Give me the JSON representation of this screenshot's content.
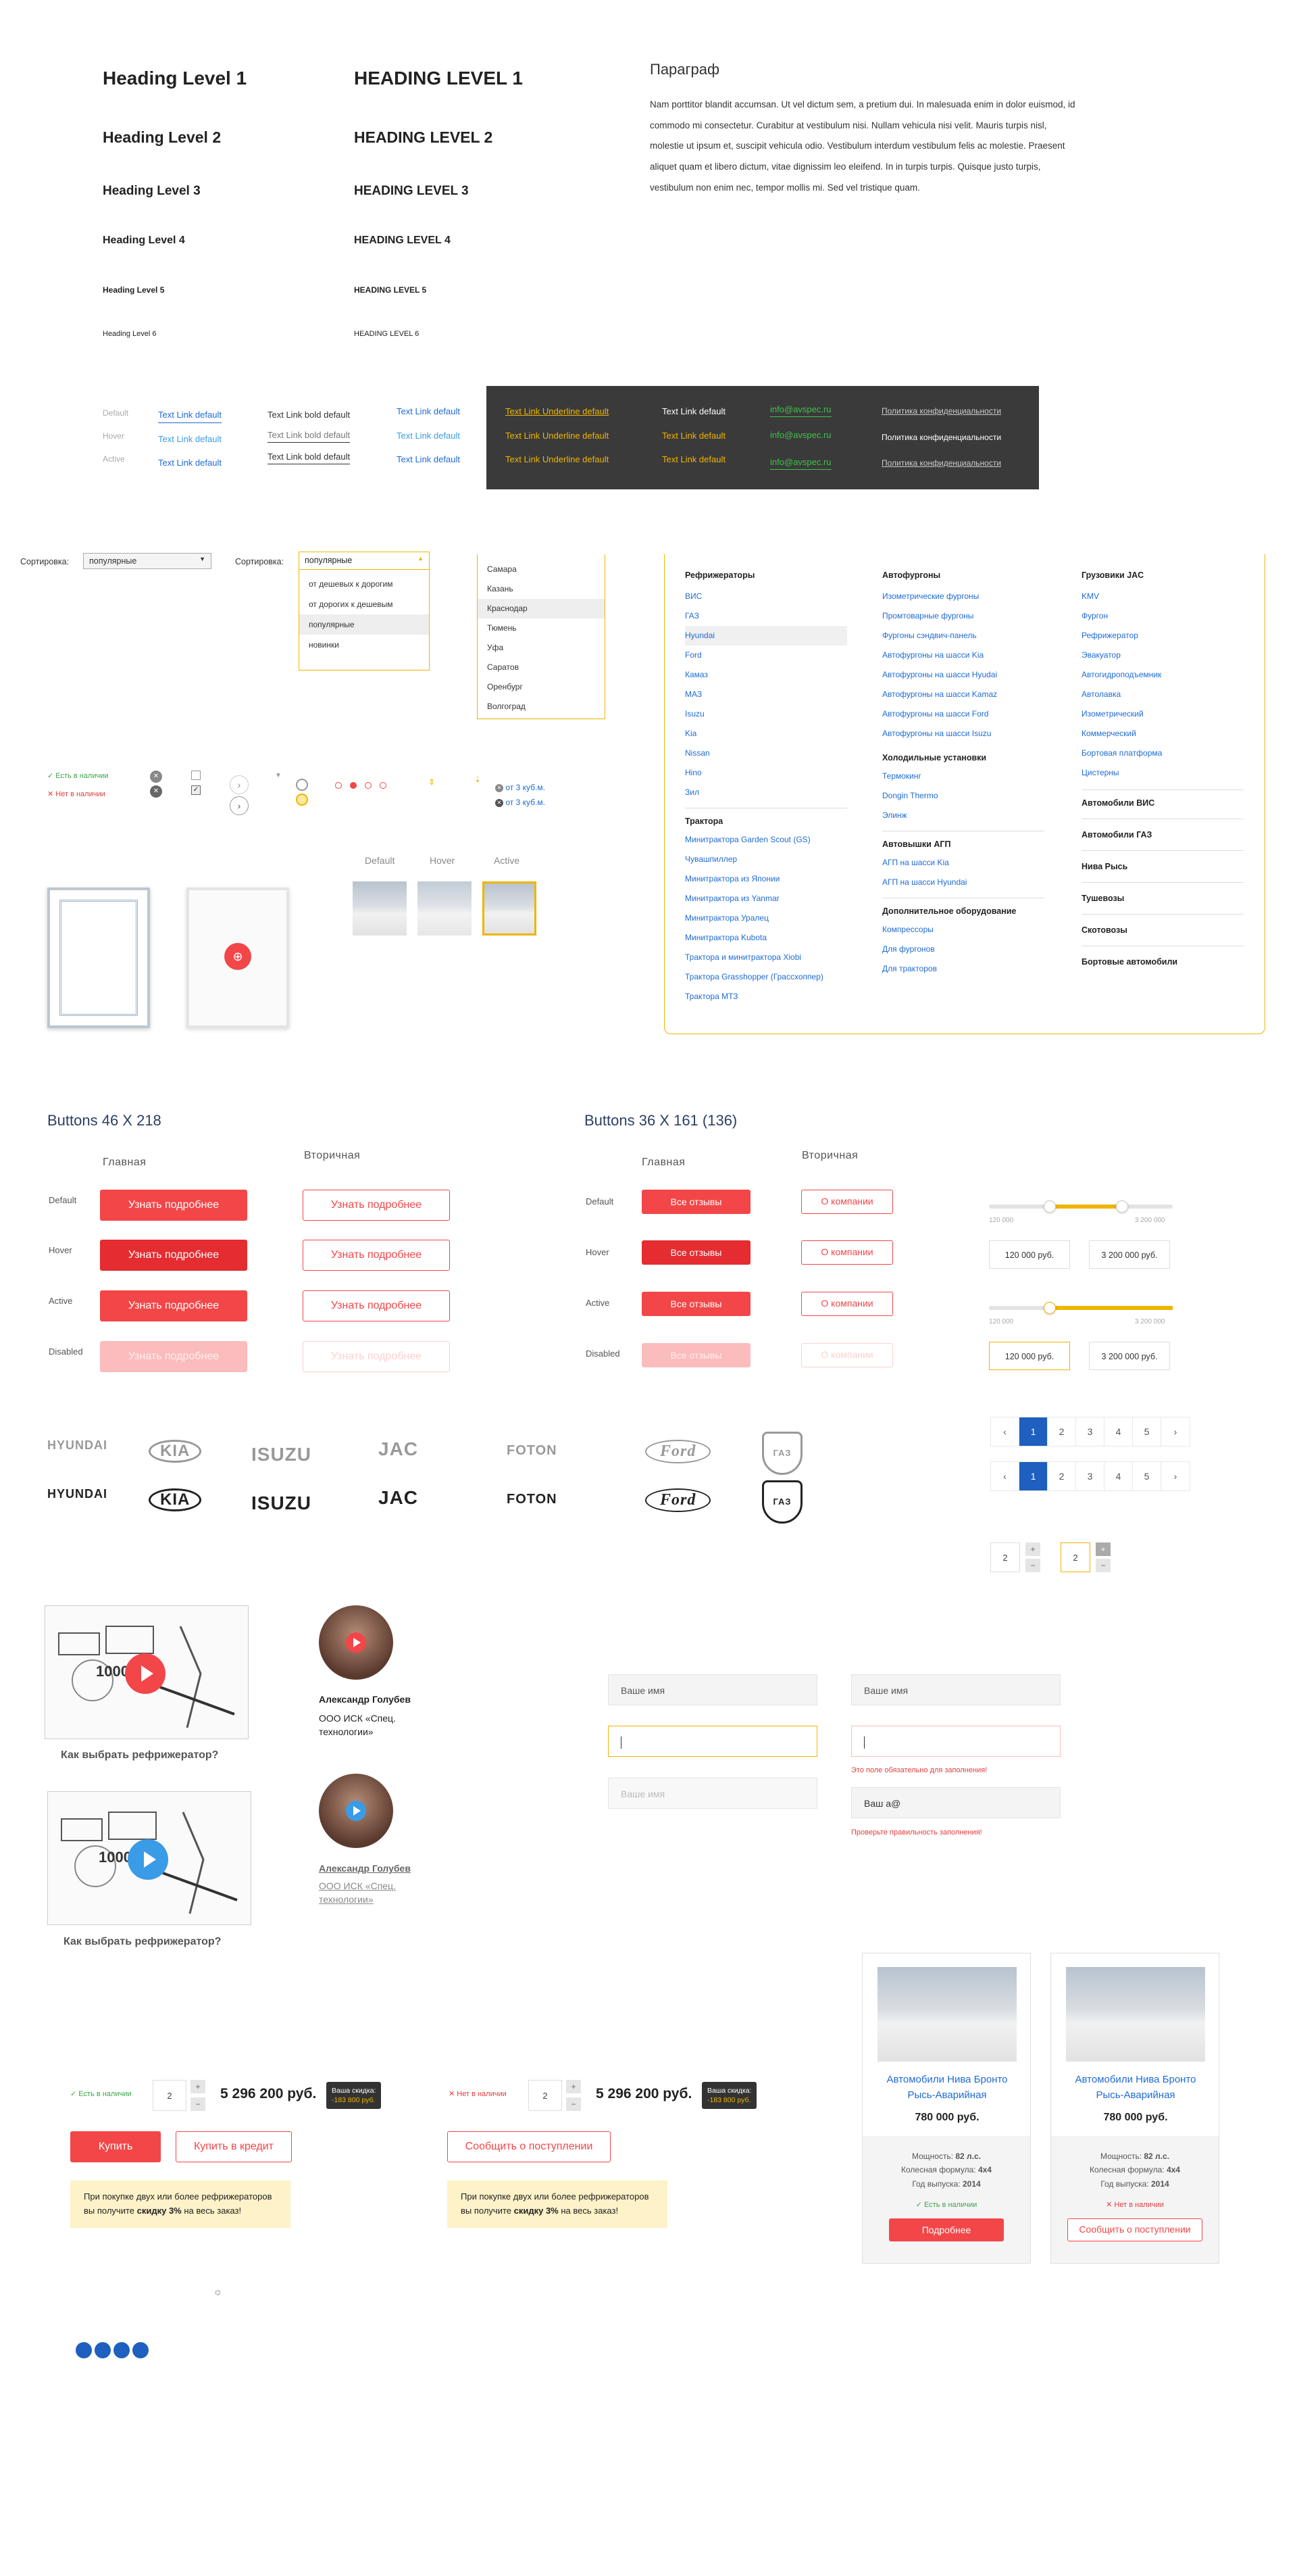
{
  "headings": {
    "h1": "Heading Level 1",
    "h2": "Heading Level 2",
    "h3": "Heading Level 3",
    "h4": "Heading Level 4",
    "h5": "Heading Level 5",
    "h6": "Heading Level 6",
    "h1u": "HEADING LEVEL 1",
    "h2u": "HEADING LEVEL 2",
    "h3u": "HEADING LEVEL 3",
    "h4u": "HEADING LEVEL 4",
    "h5u": "HEADING LEVEL 5",
    "h6u": "HEADING LEVEL 6"
  },
  "paragraph": {
    "title": "Параграф",
    "text": "Nam porttitor blandit accumsan. Ut vel dictum sem, a pretium dui. In malesuada enim in dolor euismod, id commodo mi consectetur. Curabitur at vestibulum nisi. Nullam vehicula nisi velit. Mauris turpis nisl, molestie ut ipsum et, suscipit vehicula odio. Vestibulum interdum vestibulum felis ac molestie. Praesent aliquet quam et libero dictum, vitae dignissim leo eleifend. In in turpis turpis. Quisque justo turpis, vestibulum non enim nec, tempor mollis mi. Sed vel tristique quam."
  },
  "links": {
    "states": [
      "Default",
      "Hover",
      "Active"
    ],
    "text_link_default": "Text Link default",
    "text_link_bold_default": "Text Link bold default",
    "underline_default": "Text Link Underline default",
    "email": "info@avspec.ru",
    "privacy": "Политика конфиденциальности"
  },
  "sort": {
    "label": "Сортировка:",
    "value": "популярные",
    "options": [
      "от дешевых к дорогим",
      "от дорогих к дешевым",
      "популярные",
      "новинки"
    ]
  },
  "cities": [
    "Самара",
    "Казань",
    "Краснодар",
    "Тюмень",
    "Уфа",
    "Саратов",
    "Оренбург",
    "Волгоград"
  ],
  "mega": {
    "col1": {
      "title": "Рефрижераторы",
      "items": [
        "ВИС",
        "ГАЗ",
        "Hyundai",
        "Ford",
        "Камаз",
        "МАЗ",
        "Isuzu",
        "Kia",
        "Nissan",
        "Hino",
        "Зил"
      ],
      "title2": "Трактора",
      "items2": [
        "Минитрактора Garden Scout (GS)",
        "Чувашпиллер",
        "Минитрактора из Японии",
        "Минитрактора из Yanmar",
        "Минитрактора Уралец",
        "Минитрактора Kubota",
        "Трактора и минитрактора Xiobi",
        "Трактора Grasshopper (Грассхоппер)",
        "Трактора МТЗ"
      ]
    },
    "col2": {
      "title": "Автофургоны",
      "items": [
        "Изометрические фургоны",
        "Промтоварные фургоны",
        "Фургоны сэндвич-панель",
        "Автофургоны на шасси Kia",
        "Автофургоны на шасси Hyudai",
        "Автофургоны на шасси Kamaz",
        "Автофургоны на шасси Ford",
        "Автофургоны на шасси Isuzu"
      ],
      "title2": "Холодильные установки",
      "items2": [
        "Термокинг",
        "Dongin Thermo",
        "Элинж"
      ],
      "title3": "Автовышки АГП",
      "items3": [
        "АГП на шасси Kia",
        "АГП на шасси Hyundai"
      ],
      "title4": "Дополнительное оборудование",
      "items4": [
        "Компрессоры",
        "Для фургонов",
        "Для тракторов"
      ]
    },
    "col3": {
      "title": "Грузовики JAC",
      "items": [
        "KMV",
        "Фургон",
        "Рефрижератор",
        "Эвакуатор",
        "Автогидроподъемник",
        "Автолавка",
        "Изометрический",
        "Коммерческий",
        "Бортовая платформа",
        "Цистерны"
      ],
      "extra": [
        "Автомобили ВИС",
        "Автомобили ГАЗ",
        "Нива Рысь",
        "Тушевозы",
        "Скотовозы",
        "Бортовые автомобили"
      ]
    }
  },
  "status": {
    "in_stock": "Есть в наличии",
    "out_of_stock": "Нет в наличии",
    "volume": "от 3 куб.м."
  },
  "thumb_states": [
    "Default",
    "Hover",
    "Active"
  ],
  "buttons": {
    "title_large": "Buttons 46 X 218",
    "title_small": "Buttons 36 X 161 (136)",
    "primary": "Главная",
    "secondary": "Вторичная",
    "rows": [
      "Default",
      "Hover",
      "Active",
      "Disabled"
    ],
    "learn_more": "Узнать подробнее",
    "reviews": "Все отзывы",
    "about": "О компании"
  },
  "slider": {
    "min": "120 000",
    "max": "3 200 000",
    "from": "120 000 руб.",
    "to": "3 200 000 руб.",
    "from_value": 120000,
    "to_value": 3200000,
    "handle_value_1": 2400000,
    "handle_value_2": 1100000
  },
  "brands": [
    "HYUNDAI",
    "KIA",
    "ISUZU",
    "JAC",
    "FOTON",
    "Ford",
    "ГАЗ"
  ],
  "pagination": {
    "prev": "‹",
    "next": "›",
    "pages": [
      "1",
      "2",
      "3",
      "4",
      "5"
    ],
    "current": "1"
  },
  "qty_examples": [
    "2",
    "2"
  ],
  "video": {
    "caption": "Как выбрать рефрижератор?",
    "counter": "1000"
  },
  "person": {
    "name": "Александр Голубев",
    "org": "ООО ИСК «Спец. технологии»"
  },
  "form": {
    "placeholder": "Ваше имя",
    "filled": "Ваш а@",
    "err_required": "Это поле обязательно для заполнения!",
    "err_check": "Проверьте правильность заполнения!"
  },
  "product": {
    "qty": "2",
    "price": "5 296 200 руб.",
    "discount_label": "Ваша скидка:",
    "discount_value": "-183 800 руб.",
    "buy": "Купить",
    "credit": "Купить в кредит",
    "notify": "Сообщить о поступлении",
    "promo_1": "При покупке двух или более рефрижераторов",
    "promo_2a": "вы получите ",
    "promo_2b": "скидку 3%",
    "promo_2c": " на весь заказ!"
  },
  "card": {
    "title": "Автомобили Нива Бронто Рысь-Аварийная",
    "price": "780 000 руб.",
    "power_lbl": "Мощность:",
    "power": "82 л.с.",
    "wheel_lbl": "Колесная формула:",
    "wheel": "4x4",
    "year_lbl": "Год выпуска:",
    "year": "2014",
    "more": "Подробнее"
  }
}
